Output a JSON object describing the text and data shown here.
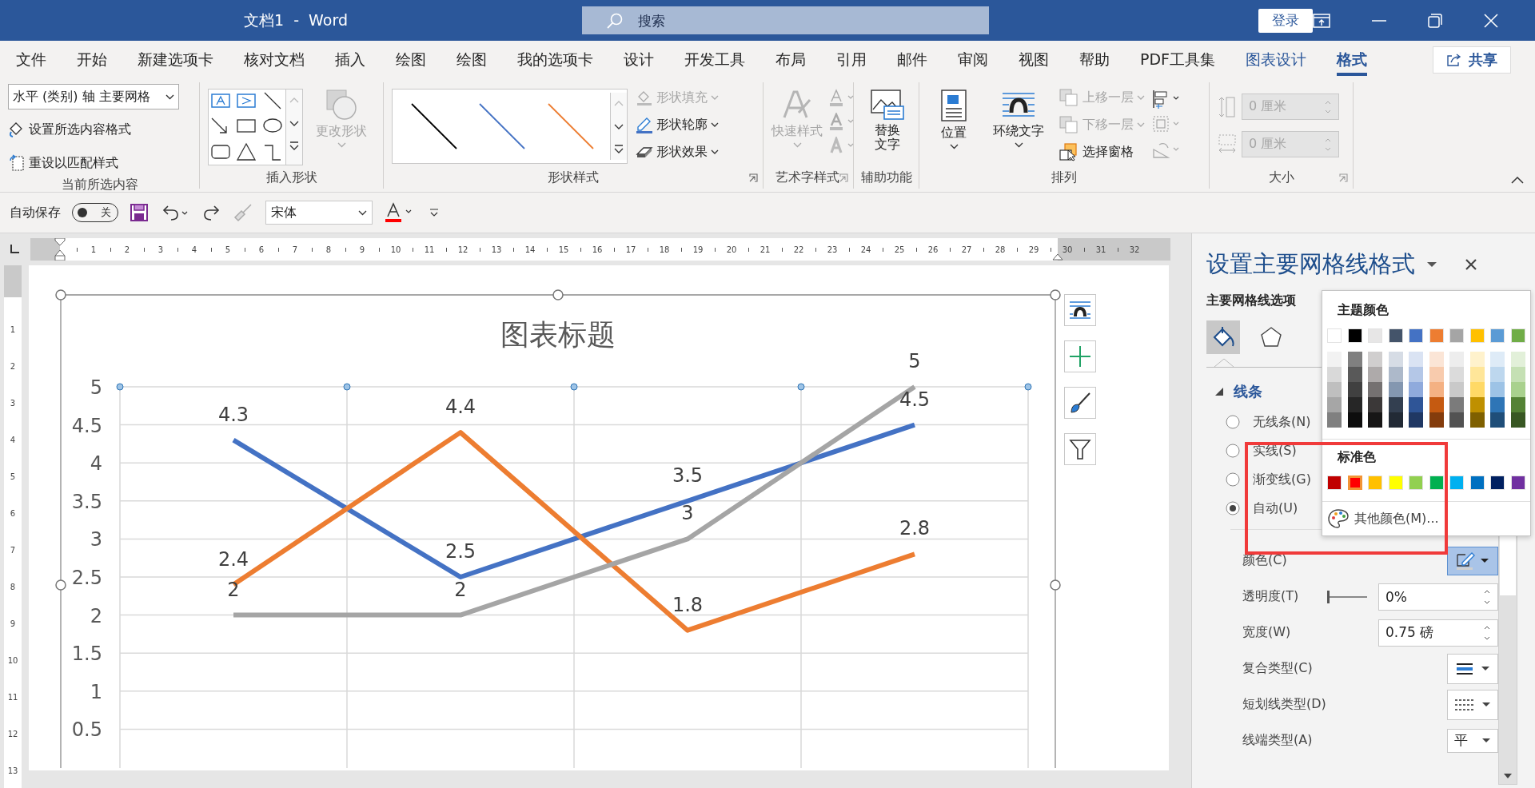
{
  "window": {
    "title": "文档1  -  Word",
    "search_placeholder": "搜索",
    "sign_in": "登录"
  },
  "tabs": [
    {
      "label": "文件",
      "selected": false,
      "contextual": false
    },
    {
      "label": "开始",
      "selected": false,
      "contextual": false
    },
    {
      "label": "新建选项卡",
      "selected": false,
      "contextual": false
    },
    {
      "label": "核对文档",
      "selected": false,
      "contextual": false
    },
    {
      "label": "插入",
      "selected": false,
      "contextual": false
    },
    {
      "label": "绘图",
      "selected": false,
      "contextual": false
    },
    {
      "label": "绘图",
      "selected": false,
      "contextual": false
    },
    {
      "label": "我的选项卡",
      "selected": false,
      "contextual": false
    },
    {
      "label": "设计",
      "selected": false,
      "contextual": false
    },
    {
      "label": "开发工具",
      "selected": false,
      "contextual": false
    },
    {
      "label": "布局",
      "selected": false,
      "contextual": false
    },
    {
      "label": "引用",
      "selected": false,
      "contextual": false
    },
    {
      "label": "邮件",
      "selected": false,
      "contextual": false
    },
    {
      "label": "审阅",
      "selected": false,
      "contextual": false
    },
    {
      "label": "视图",
      "selected": false,
      "contextual": false
    },
    {
      "label": "帮助",
      "selected": false,
      "contextual": false
    },
    {
      "label": "PDF工具集",
      "selected": false,
      "contextual": false
    },
    {
      "label": "图表设计",
      "selected": false,
      "contextual": true
    },
    {
      "label": "格式",
      "selected": true,
      "contextual": true
    }
  ],
  "share": "共享",
  "ribbon": {
    "selection_group": {
      "dropdown": "水平 (类别) 轴 主要网格",
      "buttons": [
        "设置所选内容格式",
        "重设以匹配样式"
      ],
      "label": "当前所选内容"
    },
    "shapes_group": {
      "change_shape": {
        "label": "更改形状",
        "disabled": true
      },
      "label": "插入形状"
    },
    "styles_group": {
      "commands": [
        {
          "label": "形状填充",
          "disabled": true
        },
        {
          "label": "形状轮廓",
          "disabled": false
        },
        {
          "label": "形状效果",
          "disabled": false
        }
      ],
      "label": "形状样式"
    },
    "wordart_group": {
      "quick_styles": {
        "label": "快速样式",
        "disabled": true
      },
      "label": "艺术字样式"
    },
    "accessibility_group": {
      "alt_text": "替换文字",
      "label": "辅助功能"
    },
    "arrange_group": {
      "position": "位置",
      "wrap": "环绕文字",
      "commands": [
        {
          "label": "上移一层",
          "disabled": true
        },
        {
          "label": "下移一层",
          "disabled": true
        },
        {
          "label": "选择窗格",
          "disabled": false
        }
      ],
      "label": "排列"
    },
    "size_group": {
      "height": {
        "value": "0 厘米",
        "disabled": true
      },
      "width": {
        "value": "0 厘米",
        "disabled": true
      },
      "label": "大小"
    }
  },
  "quick_access": {
    "autosave": {
      "label": "自动保存",
      "on": false,
      "state_text": "关"
    },
    "font": "宋体"
  },
  "ruler": {
    "horizontal": [
      "1",
      "2",
      "3",
      "4",
      "5",
      "6",
      "7",
      "8",
      "9",
      "10",
      "11",
      "12",
      "13",
      "14",
      "15",
      "16",
      "17",
      "18",
      "19",
      "20",
      "21",
      "22",
      "23",
      "24",
      "25",
      "26",
      "27",
      "28",
      "29",
      "30",
      "31",
      "32"
    ],
    "vertical": [
      "1",
      "2",
      "3",
      "4",
      "5",
      "6",
      "7",
      "8",
      "9",
      "10",
      "11",
      "12",
      "13"
    ]
  },
  "chart": {
    "chart_data": {
      "type": "line",
      "title": "图表标题",
      "ylim": [
        0,
        5
      ],
      "yticks": [
        0.5,
        1,
        1.5,
        2,
        2.5,
        3,
        3.5,
        4,
        4.5,
        5
      ],
      "grid": true,
      "series": [
        {
          "color": "#4472c4",
          "values": [
            4.3,
            2.5,
            3.5,
            4.5
          ],
          "value_labels": [
            "4.3",
            "2.5",
            "3.5",
            "4.5"
          ]
        },
        {
          "color": "#ed7d31",
          "values": [
            2.4,
            4.4,
            1.8,
            2.8
          ],
          "value_labels": [
            "2.4",
            "4.4",
            "1.8",
            "2.8"
          ]
        },
        {
          "color": "#a5a5a5",
          "values": [
            2,
            2,
            3,
            5
          ],
          "value_labels": [
            "2",
            "2",
            "3",
            "5"
          ]
        }
      ]
    }
  },
  "format_pane": {
    "title": "设置主要网格线格式",
    "options_label": "主要网格线选项",
    "icon_tabs": [
      {
        "kind": "fill",
        "selected": true
      },
      {
        "kind": "effects",
        "selected": false
      }
    ],
    "section": {
      "label": "线条",
      "expanded": true
    },
    "line_types": [
      {
        "label": "无线条(N)",
        "selected": false
      },
      {
        "label": "实线(S)",
        "selected": false
      },
      {
        "label": "渐变线(G)",
        "selected": false
      },
      {
        "label": "自动(U)",
        "selected": true
      }
    ],
    "properties": [
      {
        "kind": "color",
        "label": "颜色(C)"
      },
      {
        "kind": "slider",
        "label": "透明度(T)",
        "level": 0,
        "value": "0%"
      },
      {
        "kind": "spin",
        "label": "宽度(W)",
        "value": "0.75 磅"
      },
      {
        "kind": "compound",
        "label": "复合类型(C)"
      },
      {
        "kind": "dash",
        "label": "短划线类型(D)"
      },
      {
        "kind": "dropdown",
        "label": "线端类型(A)",
        "value": "平"
      }
    ]
  },
  "color_menu": {
    "theme_title": "主题颜色",
    "theme_columns": [
      {
        "color": "#ffffff",
        "shades": [
          {
            "color": "#f2f2f2"
          },
          {
            "color": "#d9d9d9"
          },
          {
            "color": "#bfbfbf"
          },
          {
            "color": "#a6a6a6"
          },
          {
            "color": "#808080"
          }
        ]
      },
      {
        "color": "#000000",
        "shades": [
          {
            "color": "#808080"
          },
          {
            "color": "#595959"
          },
          {
            "color": "#404040"
          },
          {
            "color": "#262626"
          },
          {
            "color": "#0d0d0d"
          }
        ]
      },
      {
        "color": "#e7e6e6",
        "shades": [
          {
            "color": "#d0cece"
          },
          {
            "color": "#aeaaaa"
          },
          {
            "color": "#757171"
          },
          {
            "color": "#3b3838"
          },
          {
            "color": "#171616"
          }
        ]
      },
      {
        "color": "#44546a",
        "shades": [
          {
            "color": "#d6dce5"
          },
          {
            "color": "#adb9ca"
          },
          {
            "color": "#8497b0"
          },
          {
            "color": "#333f50"
          },
          {
            "color": "#222a35"
          }
        ]
      },
      {
        "color": "#4472c4",
        "shades": [
          {
            "color": "#dae3f3"
          },
          {
            "color": "#b4c7e7"
          },
          {
            "color": "#8faadc"
          },
          {
            "color": "#2f5597"
          },
          {
            "color": "#203864"
          }
        ]
      },
      {
        "color": "#ed7d31",
        "shades": [
          {
            "color": "#fbe5d6"
          },
          {
            "color": "#f8cbad"
          },
          {
            "color": "#f4b183"
          },
          {
            "color": "#c55a11"
          },
          {
            "color": "#843c0c"
          }
        ]
      },
      {
        "color": "#a5a5a5",
        "shades": [
          {
            "color": "#ededed"
          },
          {
            "color": "#dbdbdb"
          },
          {
            "color": "#c9c9c9"
          },
          {
            "color": "#7b7b7b"
          },
          {
            "color": "#525252"
          }
        ]
      },
      {
        "color": "#ffc000",
        "shades": [
          {
            "color": "#fff2cc"
          },
          {
            "color": "#ffe699"
          },
          {
            "color": "#ffd966"
          },
          {
            "color": "#bf9000"
          },
          {
            "color": "#7f6000"
          }
        ]
      },
      {
        "color": "#5b9bd5",
        "shades": [
          {
            "color": "#deebf7"
          },
          {
            "color": "#bdd7ee"
          },
          {
            "color": "#9dc3e6"
          },
          {
            "color": "#2e75b6"
          },
          {
            "color": "#1f4e79"
          }
        ]
      },
      {
        "color": "#70ad47",
        "shades": [
          {
            "color": "#e2f0d9"
          },
          {
            "color": "#c5e0b4"
          },
          {
            "color": "#a9d18e"
          },
          {
            "color": "#548235"
          },
          {
            "color": "#385723"
          }
        ]
      }
    ],
    "standard_title": "标准色",
    "standard_colors": [
      {
        "color": "#c00000",
        "selected": false
      },
      {
        "color": "#ff0000",
        "selected": true
      },
      {
        "color": "#ffc000",
        "selected": false
      },
      {
        "color": "#ffff00",
        "selected": false
      },
      {
        "color": "#92d050",
        "selected": false
      },
      {
        "color": "#00b050",
        "selected": false
      },
      {
        "color": "#00b0f0",
        "selected": false
      },
      {
        "color": "#0070c0",
        "selected": false
      },
      {
        "color": "#002060",
        "selected": false
      },
      {
        "color": "#7030a0",
        "selected": false
      }
    ],
    "more": "其他颜色(M)..."
  },
  "highlight_frame": true
}
